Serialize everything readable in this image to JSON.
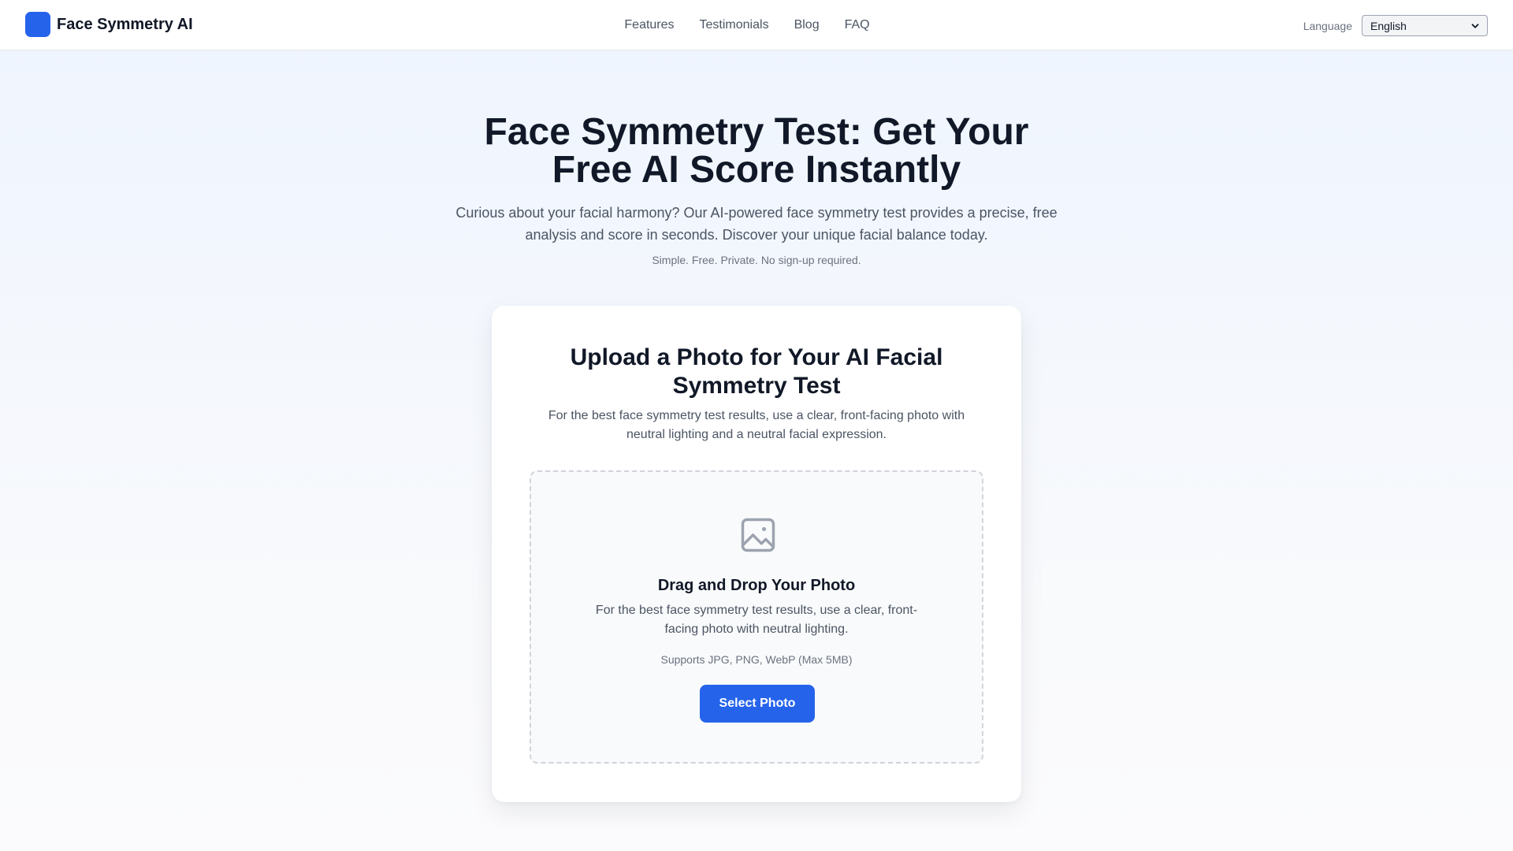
{
  "header": {
    "brand": "Face Symmetry AI",
    "brand_color": "#2563eb",
    "nav": [
      {
        "label": "Features"
      },
      {
        "label": "Testimonials"
      },
      {
        "label": "Blog"
      },
      {
        "label": "FAQ"
      }
    ],
    "language_label": "Language",
    "language_value": "English"
  },
  "hero": {
    "title": "Face Symmetry Test: Get Your Free AI Score Instantly",
    "subtitle": "Curious about your facial harmony? Our AI-powered face symmetry test provides a precise, free analysis and score in seconds. Discover your unique facial balance today.",
    "note": "Simple. Free. Private. No sign-up required."
  },
  "upload_card": {
    "title": "Upload a Photo for Your AI Facial Symmetry Test",
    "description": "For the best face symmetry test results, use a clear, front-facing photo with neutral lighting and a neutral facial expression.",
    "dropzone": {
      "icon": "image-icon",
      "title": "Drag and Drop Your Photo",
      "description": "For the best face symmetry test results, use a clear, front-facing photo with neutral lighting.",
      "supported": "Supports JPG, PNG, WebP (Max 5MB)",
      "button_label": "Select Photo"
    }
  }
}
